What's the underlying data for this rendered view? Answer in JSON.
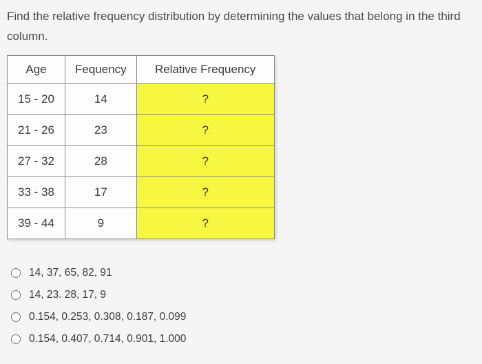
{
  "prompt": "Find the relative frequency distribution  by determining the values that belong in the third column.",
  "table": {
    "headers": {
      "age": "Age",
      "freq": "Fequency",
      "rel": "Relative Frequency"
    },
    "rows": [
      {
        "age": "15 - 20",
        "freq": "14",
        "rel": "?"
      },
      {
        "age": "21 - 26",
        "freq": "23",
        "rel": "?"
      },
      {
        "age": "27 - 32",
        "freq": "28",
        "rel": "?"
      },
      {
        "age": "33 - 38",
        "freq": "17",
        "rel": "?"
      },
      {
        "age": "39 - 44",
        "freq": "9",
        "rel": "?"
      }
    ]
  },
  "options": [
    "14, 37, 65, 82, 91",
    "14, 23. 28, 17, 9",
    "0.154, 0.253, 0.308, 0.187, 0.099",
    "0.154, 0.407, 0.714, 0.901, 1.000"
  ],
  "chart_data": {
    "type": "table",
    "columns": [
      "Age",
      "Fequency",
      "Relative Frequency"
    ],
    "rows": [
      [
        "15 - 20",
        14,
        "?"
      ],
      [
        "21 - 26",
        23,
        "?"
      ],
      [
        "27 - 32",
        28,
        "?"
      ],
      [
        "33 - 38",
        17,
        "?"
      ],
      [
        "39 - 44",
        9,
        "?"
      ]
    ]
  }
}
